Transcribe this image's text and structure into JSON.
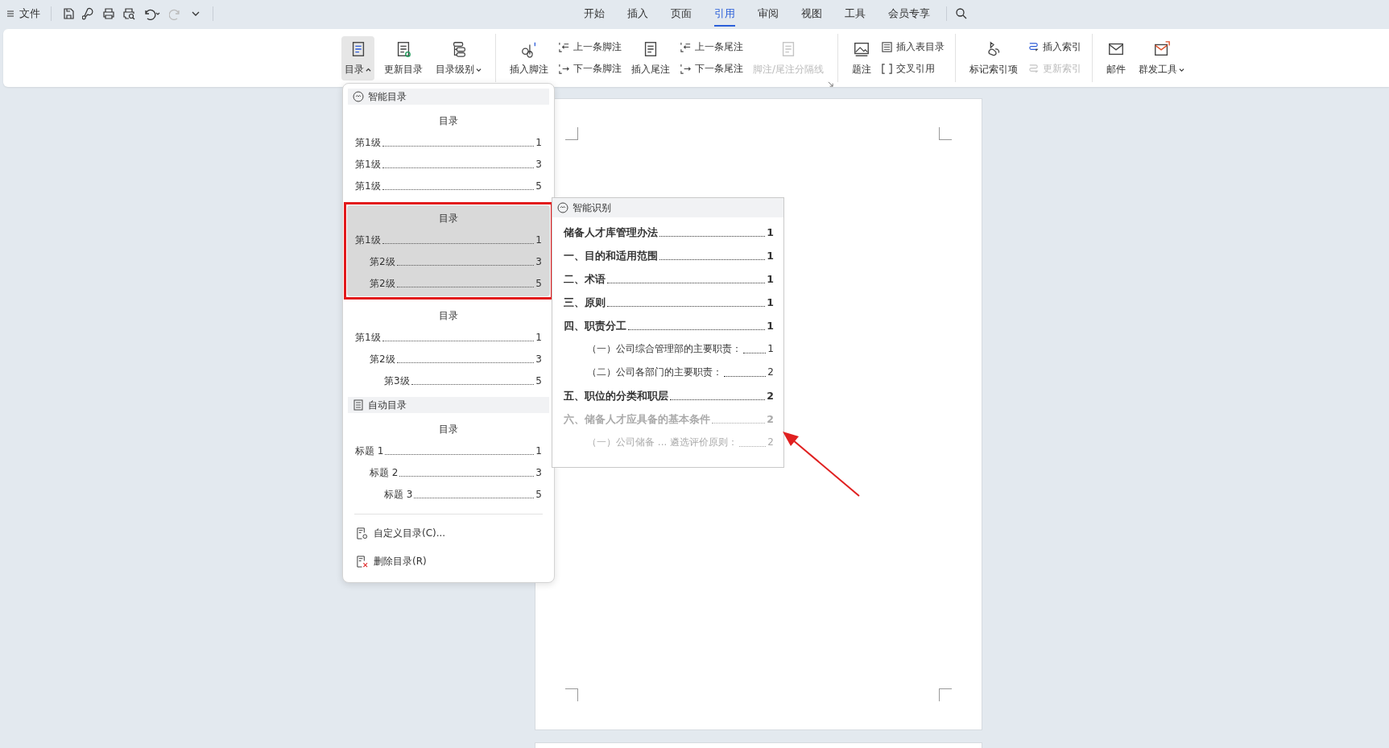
{
  "quick_access": {
    "file_menu": "文件"
  },
  "menu_tabs": [
    {
      "label": "开始",
      "selected": false
    },
    {
      "label": "插入",
      "selected": false
    },
    {
      "label": "页面",
      "selected": false
    },
    {
      "label": "引用",
      "selected": true
    },
    {
      "label": "审阅",
      "selected": false
    },
    {
      "label": "视图",
      "selected": false
    },
    {
      "label": "工具",
      "selected": false
    },
    {
      "label": "会员专享",
      "selected": false
    }
  ],
  "ribbon": {
    "groups": [
      {
        "items": [
          {
            "kind": "large",
            "label": "目录",
            "dropdown": true,
            "pressed": true,
            "disabled": false
          },
          {
            "kind": "large",
            "label": "更新目录",
            "dropdown": false,
            "pressed": false,
            "disabled": false
          },
          {
            "kind": "large",
            "label": "目录级别",
            "dropdown": true,
            "pressed": false,
            "disabled": false
          }
        ]
      },
      {
        "items": [
          {
            "kind": "large",
            "label": "插入脚注",
            "dropdown": false,
            "pressed": false,
            "disabled": false
          },
          {
            "kind": "stack",
            "buttons": [
              {
                "label": "上一条脚注",
                "disabled": false
              },
              {
                "label": "下一条脚注",
                "disabled": false
              }
            ]
          },
          {
            "kind": "large",
            "label": "插入尾注",
            "dropdown": false,
            "pressed": false,
            "disabled": false
          },
          {
            "kind": "stack",
            "buttons": [
              {
                "label": "上一条尾注",
                "disabled": false
              },
              {
                "label": "下一条尾注",
                "disabled": false
              }
            ]
          },
          {
            "kind": "large",
            "label": "脚注/尾注分隔线",
            "dropdown": false,
            "pressed": false,
            "disabled": true
          }
        ],
        "launcher": true
      },
      {
        "items": [
          {
            "kind": "large",
            "label": "题注",
            "dropdown": false,
            "pressed": false,
            "disabled": false
          },
          {
            "kind": "stack",
            "buttons": [
              {
                "label": "插入表目录",
                "disabled": false
              },
              {
                "label": "交叉引用",
                "disabled": false
              }
            ]
          }
        ]
      },
      {
        "items": [
          {
            "kind": "large",
            "label": "标记索引项",
            "dropdown": false,
            "pressed": false,
            "disabled": false
          },
          {
            "kind": "stack",
            "buttons": [
              {
                "label": "插入索引",
                "disabled": false
              },
              {
                "label": "更新索引",
                "disabled": true
              }
            ]
          }
        ]
      },
      {
        "items": [
          {
            "kind": "large",
            "label": "邮件",
            "dropdown": false,
            "pressed": false,
            "disabled": false
          },
          {
            "kind": "large",
            "label": "群发工具",
            "dropdown": true,
            "pressed": false,
            "disabled": false
          }
        ]
      }
    ]
  },
  "toc_menu": {
    "sections": [
      {
        "header": "智能目录",
        "kind": "smart",
        "presets": [
          {
            "title": "目录",
            "highlighted": false,
            "entries": [
              {
                "text": "第1级",
                "page": "1"
              },
              {
                "text": "第1级",
                "page": "3"
              },
              {
                "text": "第1级",
                "page": "5"
              }
            ]
          },
          {
            "title": "目录",
            "highlighted": true,
            "entries": [
              {
                "text": "第1级",
                "page": "1",
                "children": [
                  {
                    "text": "第2级",
                    "page": "3"
                  },
                  {
                    "text": "第2级",
                    "page": "5"
                  }
                ]
              }
            ]
          },
          {
            "title": "目录",
            "highlighted": false,
            "entries": [
              {
                "text": "第1级",
                "page": "1",
                "children": [
                  {
                    "text": "第2级",
                    "page": "3",
                    "children": [
                      {
                        "text": "第3级",
                        "page": "5"
                      }
                    ]
                  }
                ]
              }
            ]
          }
        ]
      },
      {
        "header": "自动目录",
        "kind": "auto",
        "presets": [
          {
            "title": "目录",
            "highlighted": false,
            "entries": [
              {
                "text": "标题 1",
                "page": "1",
                "children": [
                  {
                    "text": "标题 2",
                    "page": "3",
                    "children": [
                      {
                        "text": "标题 3",
                        "page": "5"
                      }
                    ]
                  }
                ]
              }
            ]
          }
        ]
      }
    ],
    "actions": [
      {
        "kind": "custom",
        "label": "自定义目录(C)..."
      },
      {
        "kind": "delete",
        "label": "删除目录(R)"
      }
    ]
  },
  "smart_preview": {
    "header": "智能识别",
    "entries": [
      {
        "text": "储备人才库管理办法",
        "page": "1",
        "dimmed": false
      },
      {
        "text": "一、目的和适用范围",
        "page": "1",
        "dimmed": false
      },
      {
        "text": "二、术语",
        "page": "1",
        "dimmed": false
      },
      {
        "text": "三、原则",
        "page": "1",
        "dimmed": false
      },
      {
        "text": "四、职责分工",
        "page": "1",
        "dimmed": false,
        "children": [
          {
            "text": "（一）公司综合管理部的主要职责：",
            "page": "1",
            "dimmed": false
          },
          {
            "text": "（二）公司各部门的主要职责：",
            "page": "2",
            "dimmed": false
          }
        ]
      },
      {
        "text": "五、职位的分类和职层",
        "page": "2",
        "dimmed": false
      },
      {
        "text": "六、储备人才应具备的基本条件",
        "page": "2",
        "dimmed": true,
        "children": [
          {
            "text": "（一）公司储备  ...  遴选评价原则：",
            "page": "2",
            "dimmed": true
          }
        ]
      }
    ]
  }
}
